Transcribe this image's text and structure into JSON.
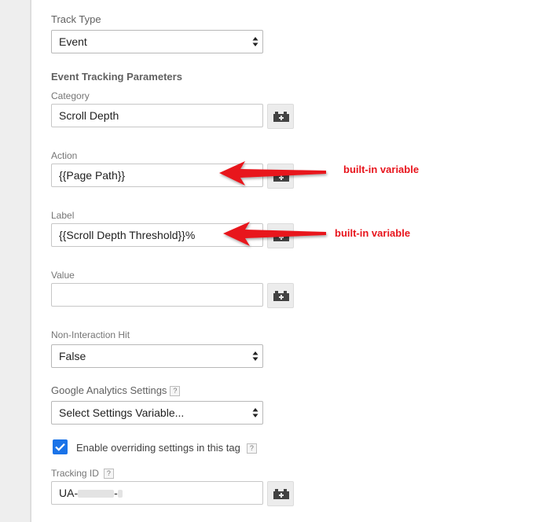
{
  "track_type": {
    "label": "Track Type",
    "value": "Event"
  },
  "event_params": {
    "heading": "Event Tracking Parameters",
    "category": {
      "label": "Category",
      "value": "Scroll Depth"
    },
    "action": {
      "label": "Action",
      "value": "{{Page Path}}"
    },
    "label": {
      "label": "Label",
      "value": "{{Scroll Depth Threshold}}%"
    },
    "value": {
      "label": "Value",
      "value": ""
    }
  },
  "non_interaction": {
    "label": "Non-Interaction Hit",
    "value": "False"
  },
  "ga_settings": {
    "label": "Google Analytics Settings",
    "help": "?",
    "value": "Select Settings Variable..."
  },
  "override": {
    "label": "Enable overriding settings in this tag",
    "help": "?",
    "checked": true
  },
  "tracking_id": {
    "label": "Tracking ID",
    "help": "?",
    "prefix": "UA-",
    "separator": "-"
  },
  "annotations": {
    "action_note": "built-in variable",
    "label_note": "built-in variable",
    "arrow_color": "#e8141c"
  },
  "colors": {
    "checkbox": "#1a73e8",
    "icon": "#424242"
  }
}
